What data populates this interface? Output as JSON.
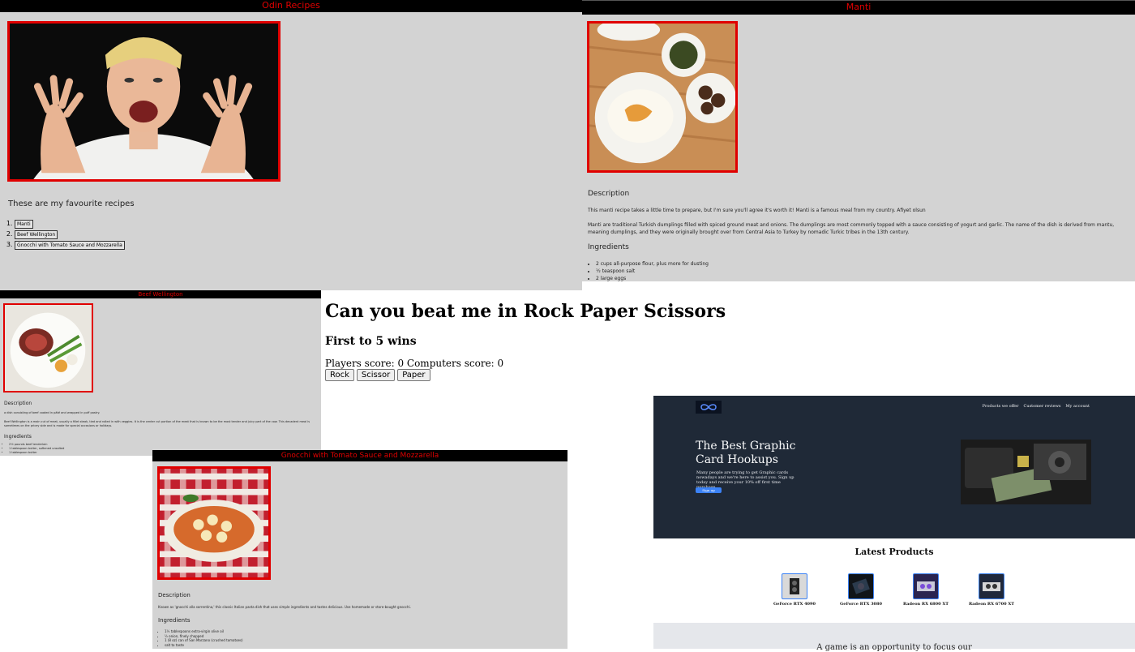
{
  "home": {
    "title": "Odin Recipes",
    "heading": "These are my favourite recipes",
    "links": [
      "Manti",
      "Beef Wellington",
      "Gnocchi with Tomato Sauce and Mozzarella"
    ]
  },
  "manti": {
    "title": "Manti",
    "description_heading": "Description",
    "para1": "This manti recipe takes a little time to prepare, but I'm sure you'll agree it's worth it! Manti is a famous meal from my country. Afiyet olsun",
    "para2": "Manti are traditional Turkish dumplings filled with spiced ground meat and onions. The dumplings are most commonly topped with a sauce consisting of yogurt and garlic. The name of the dish is derived from mantu, meaning dumplings, and they were originally brought over from Central Asia to Turkey by nomadic Turkic tribes in the 13th century.",
    "ingredients_heading": "Ingredients",
    "ingredients": [
      "2 cups all-purpose flour, plus more for dusting",
      "½ teaspoon salt",
      "2 large eggs"
    ]
  },
  "wellington": {
    "title": "Beef Wellington",
    "description_heading": "Description",
    "para1": "a dish consisting of beef coated in pâté and wrapped in puff pastry.",
    "para2": "Beef Wellington is a main cut of meat, usually a fillet steak, tied and rolled in with veggies. It is the center cut portion of the meat that is known to be the most tender and juicy part of the cow. This decadent meal is sometimes on the pricey side and is made for special occasions or holidays.",
    "ingredients_heading": "Ingredients",
    "ingredients": [
      "2½ pounds beef tenderloin",
      "1 tablespoon butter, softened unsalted",
      "1 tablespoon butter"
    ]
  },
  "gnocchi": {
    "title": "Gnocchi with Tomato Sauce and Mozzarella",
    "description_heading": "Description",
    "para1": "Known as 'gnocchi alla sorrentina,' this classic Italian pasta dish that uses simple ingredients and tastes delicious. Use homemade or store-bought gnocchi.",
    "ingredients_heading": "Ingredients",
    "ingredients": [
      "1½ tablespoons extra-virgin olive oil",
      "½ onion, finely chopped",
      "1 (8 oz) can of San Marzano (crushed tomatoes)",
      "salt to taste"
    ]
  },
  "rps": {
    "title": "Can you beat me in Rock Paper Scissors",
    "subtitle": "First to 5 wins",
    "score": "Players score: 0 Computers score: 0",
    "buttons": [
      "Rock",
      "Scissor",
      "Paper"
    ]
  },
  "gpu": {
    "nav": [
      "Products we offer",
      "Customer reviews",
      "My account"
    ],
    "headline": "The Best Graphic Card Hookups",
    "sub": "Many people are trying to get Graphic cards nowadays and we're here to assist you. Sign up today and receive your 10% off first time purchase.",
    "signup": "Sign up",
    "latest": "Latest Products",
    "products": [
      "GeForce RTX 4090",
      "GeForce RTX 3080",
      "Radeon RX 6800 XT",
      "Radeon RX 6700 XT"
    ],
    "quote": "A game is an opportunity to focus our"
  }
}
